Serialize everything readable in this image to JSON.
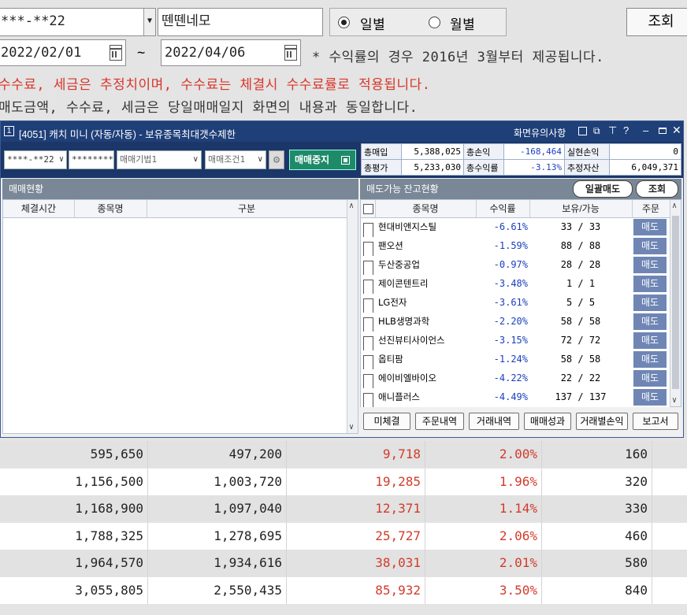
{
  "top_form": {
    "account_value": "***-**22",
    "account_name": "뗀뗀네모",
    "radio_daily": "일별",
    "radio_monthly": "월별",
    "search_button": "조회",
    "date_from": "2022/02/01",
    "date_sep": "~",
    "date_to": "2022/04/06",
    "note_profit": "* 수익률의 경우 2016년 3월부터 제공됩니다.",
    "note_fee": "수수료, 세금은 추정치이며, 수수료는 체결시 수수료률로 적용됩니다.",
    "note_sell": "매도금액, 수수료, 세금은 당일매매일지 화면의 내용과 동일합니다."
  },
  "popup": {
    "badge": "1",
    "title": "[4051] 캐치 미니 (자동/자동) - 보유종목최대갯수제한",
    "notice": "화면유의사항",
    "account": "****-**22",
    "password": "********",
    "method": "매매기법1",
    "condition": "매매조건1",
    "stop_button": "매매중지",
    "summary": {
      "buy_label": "총매입",
      "buy_value": "5,388,025",
      "pl_label": "총손익",
      "pl_value": "-168,464",
      "realized_label": "실현손익",
      "realized_value": "0",
      "eval_label": "총평가",
      "eval_value": "5,233,030",
      "rate_label": "총수익률",
      "rate_value": "-3.13%",
      "asset_label": "추정자산",
      "asset_value": "6,049,371"
    },
    "left_section": "매매현황",
    "left_headers": [
      "체결시간",
      "종목명",
      "구분"
    ],
    "right_section": "매도가능 잔고현황",
    "sell_all_button": "일괄매도",
    "refresh_button": "조회",
    "right_headers": [
      "종목명",
      "수익률",
      "보유/가능",
      "주문"
    ],
    "holdings": [
      {
        "name": "현대비앤지스틸",
        "rate": "-6.61%",
        "qty": "33 / 33",
        "order": "매도"
      },
      {
        "name": "팬오션",
        "rate": "-1.59%",
        "qty": "88 / 88",
        "order": "매도"
      },
      {
        "name": "두산중공업",
        "rate": "-0.97%",
        "qty": "28 / 28",
        "order": "매도"
      },
      {
        "name": "제이콘텐트리",
        "rate": "-3.48%",
        "qty": "1 / 1",
        "order": "매도"
      },
      {
        "name": "LG전자",
        "rate": "-3.61%",
        "qty": "5 / 5",
        "order": "매도"
      },
      {
        "name": "HLB생명과학",
        "rate": "-2.20%",
        "qty": "58 / 58",
        "order": "매도"
      },
      {
        "name": "선진뷰티사이언스",
        "rate": "-3.15%",
        "qty": "72 / 72",
        "order": "매도"
      },
      {
        "name": "옵티팜",
        "rate": "-1.24%",
        "qty": "58 / 58",
        "order": "매도"
      },
      {
        "name": "에이비엘바이오",
        "rate": "-4.22%",
        "qty": "22 / 22",
        "order": "매도"
      },
      {
        "name": "애니플러스",
        "rate": "-4.49%",
        "qty": "137 / 137",
        "order": "매도"
      }
    ],
    "bottom_buttons": [
      "미체결",
      "주문내역",
      "거래내역",
      "매매성과",
      "거래별손익",
      "보고서"
    ]
  },
  "daily_table": [
    [
      "595,650",
      "497,200",
      "9,718",
      "2.00%",
      "160"
    ],
    [
      "1,156,500",
      "1,003,720",
      "19,285",
      "1.96%",
      "320"
    ],
    [
      "1,168,900",
      "1,097,040",
      "12,371",
      "1.14%",
      "330"
    ],
    [
      "1,788,325",
      "1,278,695",
      "25,727",
      "2.06%",
      "460"
    ],
    [
      "1,964,570",
      "1,934,616",
      "38,031",
      "2.01%",
      "580"
    ],
    [
      "3,055,805",
      "2,550,435",
      "85,932",
      "3.50%",
      "840"
    ]
  ],
  "colors": {
    "title_bar": "#1f3f78",
    "negative": "#1a3fbf",
    "profit": "#d23b2b",
    "stop_button": "#1e8a6a",
    "sell_button": "#6f86b5"
  }
}
